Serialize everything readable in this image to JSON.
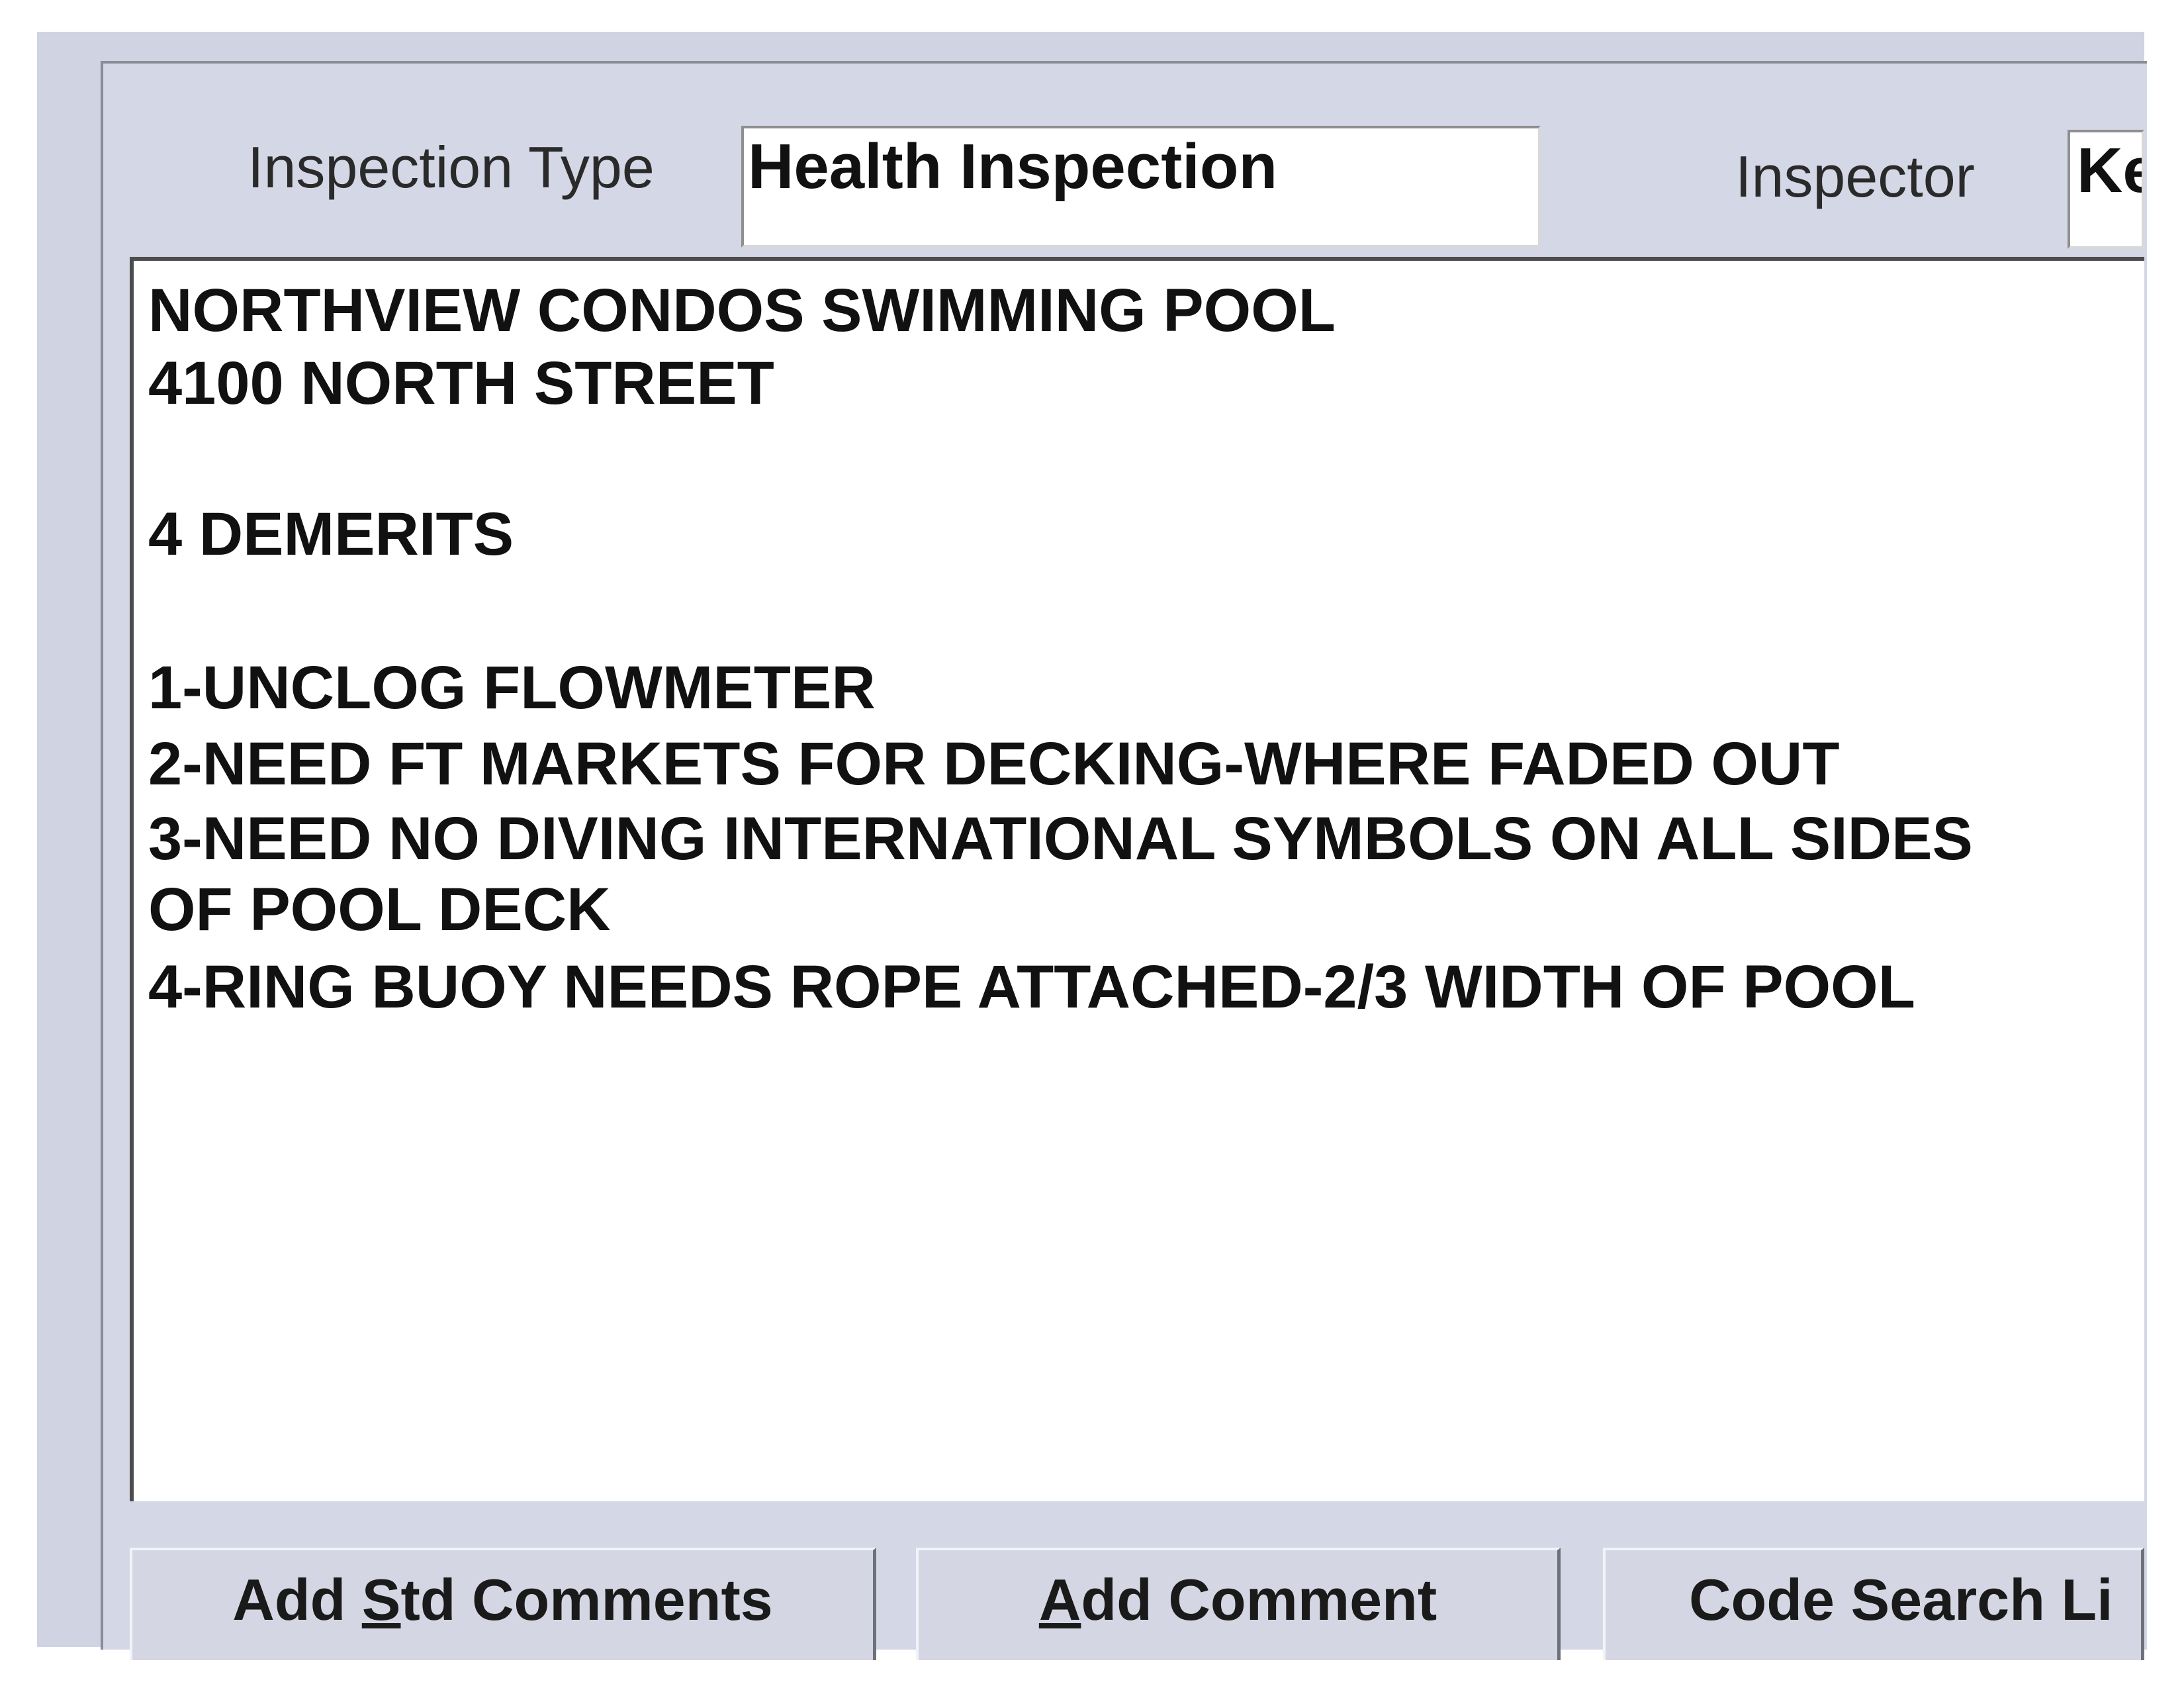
{
  "form": {
    "inspection_type_label": "Inspection Type",
    "inspection_type_value": "Health Inspection",
    "inspector_label": "Inspector",
    "inspector_value": "Ke"
  },
  "comments": {
    "lines": [
      "NORTHVIEW CONDOS SWIMMING POOL",
      "4100 NORTH STREET",
      "",
      "4 DEMERITS",
      "",
      "1-UNCLOG FLOWMETER",
      "2-NEED FT MARKETS FOR DECKING-WHERE FADED OUT",
      "3-NEED NO DIVING INTERNATIONAL SYMBOLS ON ALL SIDES",
      "OF POOL DECK",
      "4-RING BUOY NEEDS ROPE ATTACHED-2/3 WIDTH OF POOL"
    ]
  },
  "buttons": {
    "add_std_comments": {
      "before": "Add ",
      "mnemonic": "S",
      "after": "td Comments"
    },
    "add_comment": {
      "before": "",
      "mnemonic": "A",
      "after": "dd Comment"
    },
    "code_search": {
      "label": "Code Search Li"
    }
  }
}
